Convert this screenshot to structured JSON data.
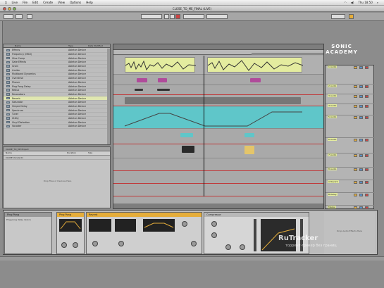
{
  "menubar": {
    "items": [
      "Live",
      "File",
      "Edit",
      "Create",
      "View",
      "Options",
      "Help"
    ],
    "clock": "Thu 18:50"
  },
  "window": {
    "title": "CLOSE_TO_ME_FINAL (LIVE)"
  },
  "browser": {
    "header": [
      "Name",
      "Type",
      "Date Modified"
    ],
    "rows": [
      {
        "name": "Effects",
        "type": "Ableton Device",
        "selected": false
      },
      {
        "name": "Frequency (MIDI)",
        "type": "Ableton Device",
        "selected": false
      },
      {
        "name": "Glue Comp",
        "type": "Ableton Device",
        "selected": false
      },
      {
        "name": "Gate Effects",
        "type": "Ableton Device",
        "selected": false
      },
      {
        "name": "Grain",
        "type": "Ableton Device",
        "selected": false
      },
      {
        "name": "Limiter",
        "type": "Ableton Device",
        "selected": false
      },
      {
        "name": "Multiband Dynamics",
        "type": "Ableton Device",
        "selected": false
      },
      {
        "name": "Overdrive",
        "type": "Ableton Device",
        "selected": false
      },
      {
        "name": "Phaser",
        "type": "Ableton Device",
        "selected": false
      },
      {
        "name": "Ping Pong Delay",
        "type": "Ableton Device",
        "selected": false
      },
      {
        "name": "Redux",
        "type": "Ableton Device",
        "selected": false
      },
      {
        "name": "Resonators",
        "type": "Ableton Device",
        "selected": false
      },
      {
        "name": "Reverb",
        "type": "Ableton Device",
        "selected": true
      },
      {
        "name": "Saturator",
        "type": "Ableton Device",
        "selected": false
      },
      {
        "name": "Simple Delay",
        "type": "Ableton Device",
        "selected": false
      },
      {
        "name": "Spectrum",
        "type": "Ableton Device",
        "selected": false
      },
      {
        "name": "Tuner",
        "type": "Ableton Device",
        "selected": false
      },
      {
        "name": "Utility",
        "type": "Ableton Device",
        "selected": false
      },
      {
        "name": "Vinyl Distortion",
        "type": "Ableton Device",
        "selected": false
      },
      {
        "name": "Vocoder",
        "type": "Ableton Device",
        "selected": false
      }
    ]
  },
  "info": {
    "path": "CLOSE_TO_ME Project",
    "cols": [
      "Name",
      "Duration",
      "Size"
    ],
    "row1": "CLOSE Vocals 01",
    "empty": "Drop Files or Devices Here"
  },
  "logo": {
    "line1": "SONIC",
    "line2": "ACADEMY"
  },
  "mixer": {
    "tracks": [
      "1 Audio",
      "2 Audio",
      "3 Audio",
      "4 Audio",
      "5 Audio",
      "6 Audio",
      "7 Audio",
      "8 Audio",
      "A Reverb",
      "B Delay",
      "Master"
    ]
  },
  "devices": {
    "d1": {
      "title": "Ping Pong",
      "note": "Ping pong delay device"
    },
    "d2": {
      "title": "Reverb"
    },
    "d3": {
      "title": "Compressor"
    },
    "hint": "Drop Audio Effects Here"
  },
  "watermark": {
    "big": "RuTracker",
    "small": "торрент-трекер без границ"
  }
}
